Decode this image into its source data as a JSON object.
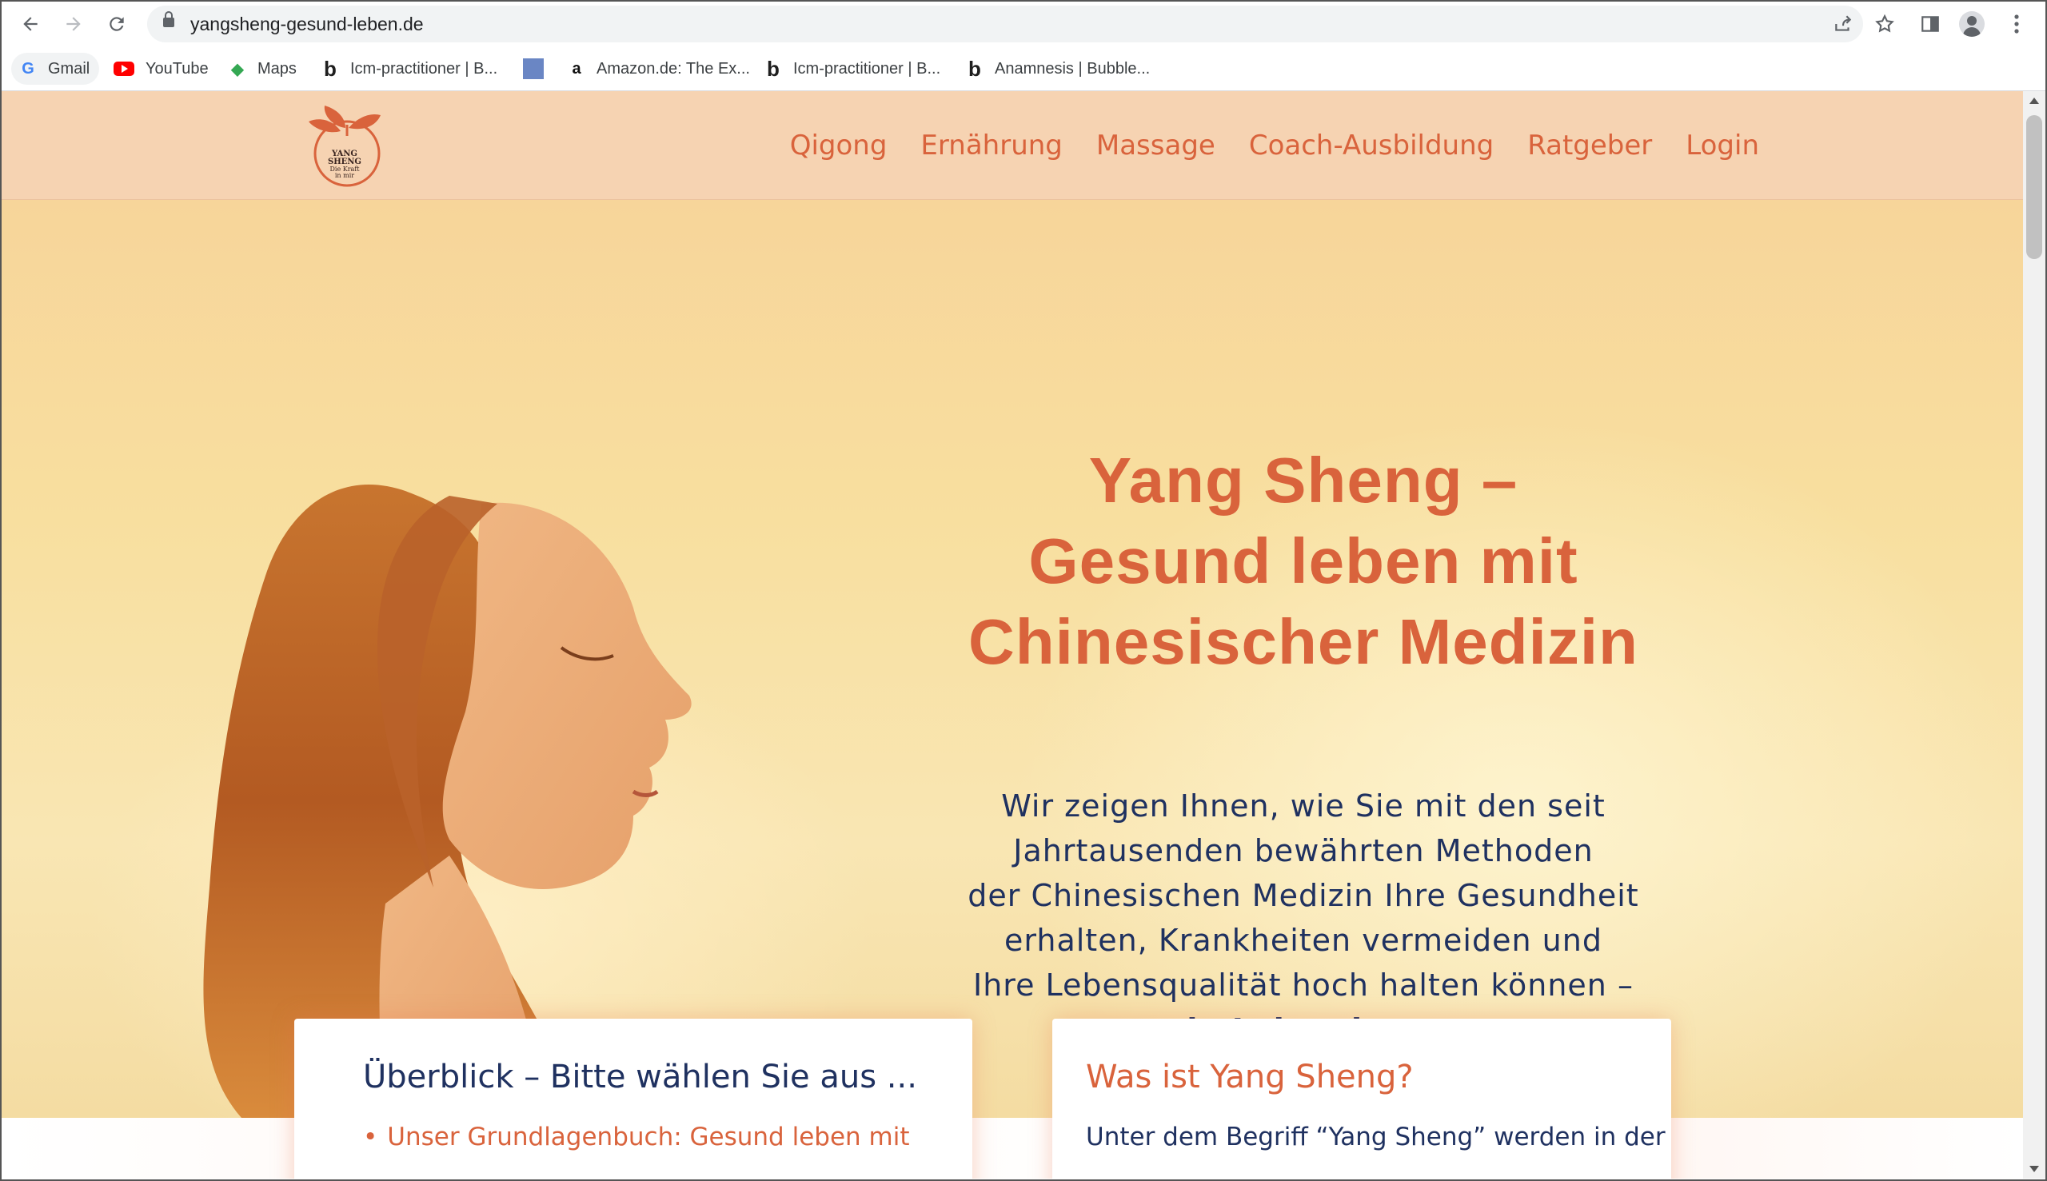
{
  "browser": {
    "url": "yangsheng-gesund-leben.de",
    "bookmarks": [
      {
        "label": "Gmail",
        "icon": "google-icon"
      },
      {
        "label": "YouTube",
        "icon": "youtube-icon"
      },
      {
        "label": "Maps",
        "icon": "maps-icon"
      },
      {
        "label": "Icm-practitioner | B...",
        "icon": "bubble-icon"
      },
      {
        "label": "",
        "icon": "blue-square-icon"
      },
      {
        "label": "Amazon.de: The Ex...",
        "icon": "amazon-icon"
      },
      {
        "label": "Icm-practitioner | B...",
        "icon": "bubble-icon"
      },
      {
        "label": "Anamnesis | Bubble...",
        "icon": "bubble-icon"
      }
    ]
  },
  "site": {
    "logo": {
      "title_1": "YANG",
      "title_2": "SHENG",
      "sub_1": "Die Kraft",
      "sub_2": "in mir"
    },
    "nav": [
      "Qigong",
      "Ernährung",
      "Massage",
      "Coach-Ausbildung",
      "Ratgeber",
      "Login"
    ],
    "hero": {
      "title_lines": [
        "Yang Sheng –",
        "Gesund leben mit",
        "Chinesischer Medizin"
      ],
      "text_lines": [
        "Wir zeigen Ihnen, wie Sie mit den seit",
        "Jahrtausenden bewährten Methoden",
        "der Chinesischen Medizin Ihre Gesundheit",
        "erhalten, Krankheiten vermeiden und",
        "Ihre Lebensqualität hoch halten können –"
      ],
      "text_emphasis": "ein Leben lang."
    },
    "cards": [
      {
        "title": "Überblick – Bitte wählen Sie aus ...",
        "item": "Unser Grundlagenbuch: Gesund leben mit"
      },
      {
        "title": "Was ist Yang Sheng?",
        "text": "Unter dem Begriff “Yang Sheng” werden in der"
      }
    ]
  },
  "colors": {
    "accent": "#d9633c",
    "navy": "#1f3160",
    "header_bg": "#f6d3b2"
  }
}
